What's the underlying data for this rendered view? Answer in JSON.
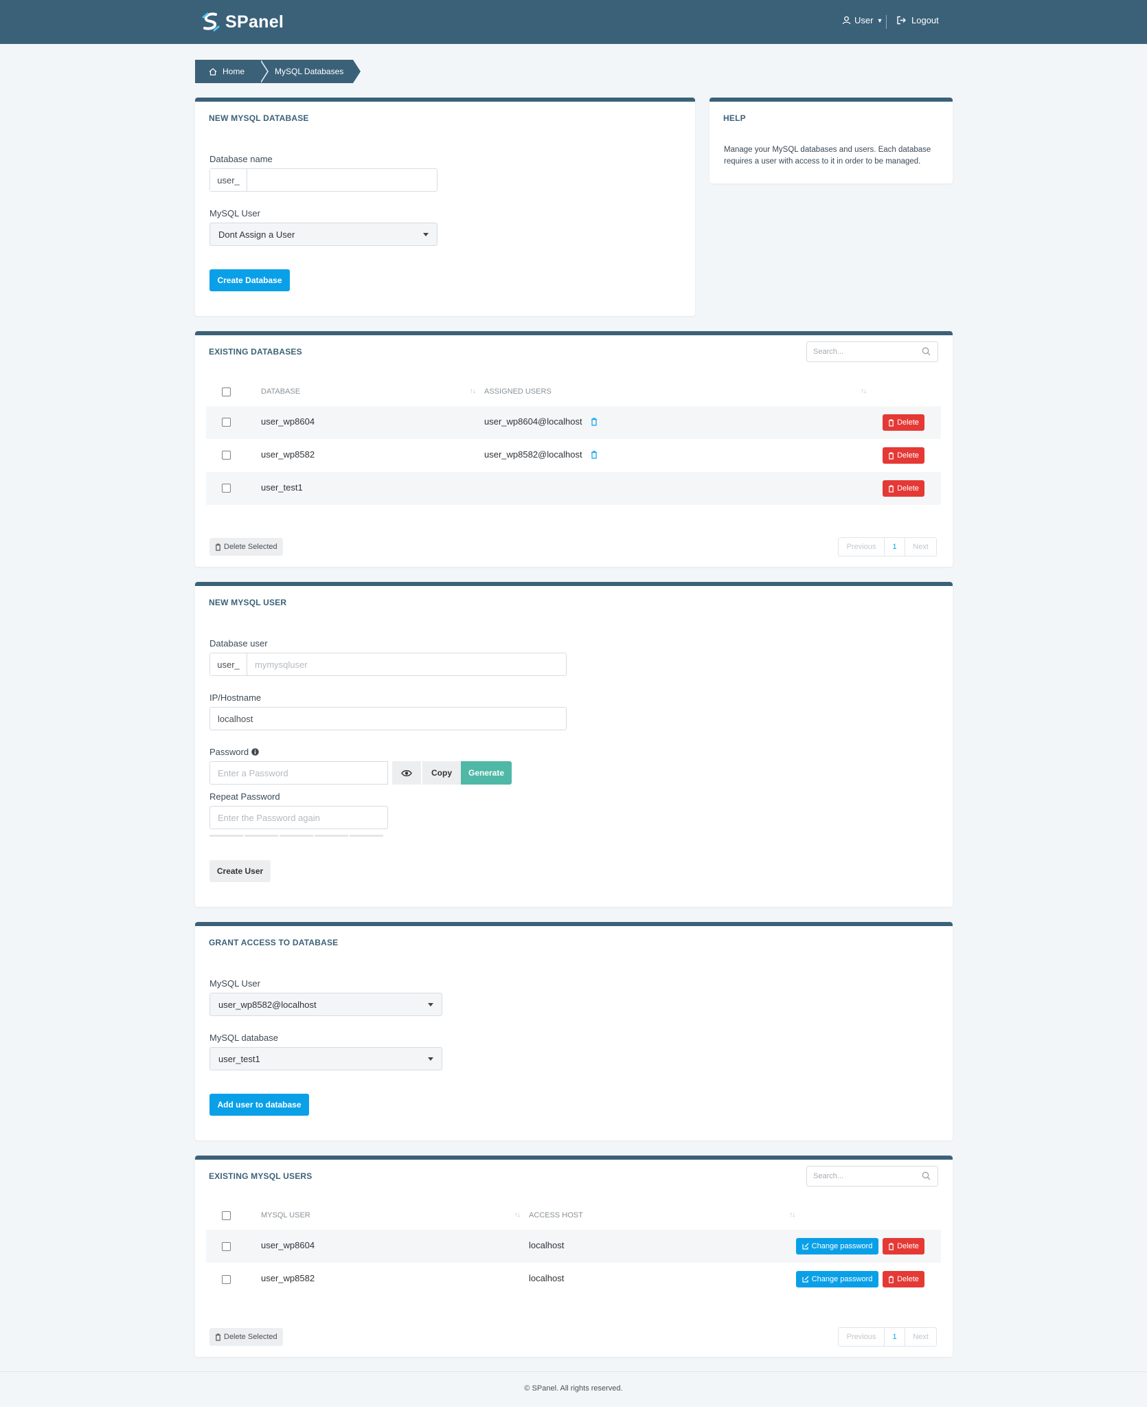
{
  "header": {
    "brand": "SPanel",
    "user_label": "User",
    "logout_label": "Logout"
  },
  "breadcrumb": {
    "home": "Home",
    "current": "MySQL Databases"
  },
  "new_database": {
    "title": "NEW MYSQL DATABASE",
    "name_label": "Database name",
    "prefix": "user_",
    "name_value": "",
    "user_label": "MySQL User",
    "user_selected": "Dont Assign a User",
    "submit": "Create Database"
  },
  "help": {
    "title": "HELP",
    "text": "Manage your MySQL databases and users. Each database requires a user with access to it in order to be managed."
  },
  "existing_databases": {
    "title": "EXISTING DATABASES",
    "search_placeholder": "Search...",
    "columns": [
      "DATABASE",
      "ASSIGNED USERS"
    ],
    "rows": [
      {
        "database": "user_wp8604",
        "assigned": "user_wp8604@localhost",
        "action": "Delete"
      },
      {
        "database": "user_wp8582",
        "assigned": "user_wp8582@localhost",
        "action": "Delete"
      },
      {
        "database": "user_test1",
        "assigned": "",
        "action": "Delete"
      }
    ],
    "delete_selected": "Delete Selected",
    "pager": {
      "prev": "Previous",
      "page": "1",
      "next": "Next"
    }
  },
  "new_user": {
    "title": "NEW MYSQL USER",
    "user_label": "Database user",
    "prefix": "user_",
    "user_placeholder": "mymysqluser",
    "host_label": "IP/Hostname",
    "host_value": "localhost",
    "password_label": "Password",
    "password_placeholder": "Enter a Password",
    "copy_label": "Copy",
    "generate_label": "Generate",
    "repeat_label": "Repeat Password",
    "repeat_placeholder": "Enter the Password again",
    "submit": "Create User"
  },
  "grant": {
    "title": "GRANT ACCESS TO DATABASE",
    "user_label": "MySQL User",
    "user_selected": "user_wp8582@localhost",
    "db_label": "MySQL database",
    "db_selected": "user_test1",
    "submit": "Add user to database"
  },
  "existing_users": {
    "title": "EXISTING MYSQL USERS",
    "search_placeholder": "Search...",
    "columns": [
      "MYSQL USER",
      "ACCESS HOST"
    ],
    "rows": [
      {
        "user": "user_wp8604",
        "host": "localhost",
        "change": "Change password",
        "delete": "Delete"
      },
      {
        "user": "user_wp8582",
        "host": "localhost",
        "change": "Change password",
        "delete": "Delete"
      }
    ],
    "delete_selected": "Delete Selected",
    "pager": {
      "prev": "Previous",
      "page": "1",
      "next": "Next"
    }
  },
  "footer": "© SPanel. All rights reserved.",
  "colors": {
    "brand": "#3b6179",
    "primary": "#0aa0e8",
    "danger": "#e53935",
    "generate": "#4fb8a6"
  },
  "icons": [
    "spanel-logo-icon",
    "user-icon",
    "logout-icon",
    "home-icon",
    "search-icon",
    "trash-icon",
    "edit-icon",
    "eye-icon",
    "info-icon",
    "chevron-down-icon"
  ]
}
